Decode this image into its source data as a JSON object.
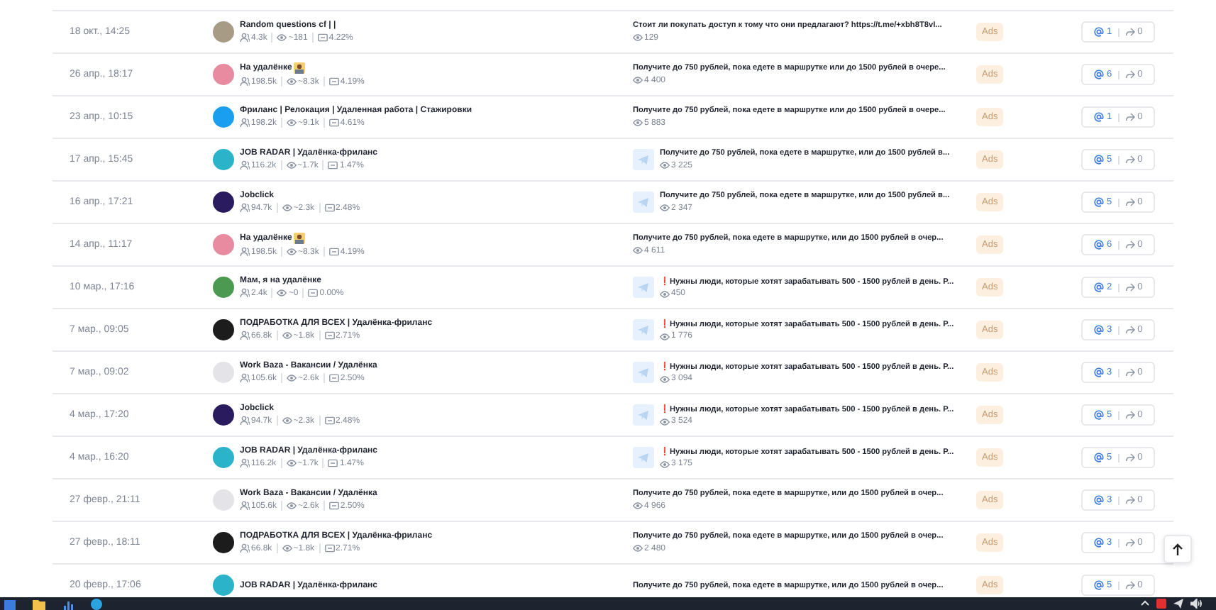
{
  "rows": [
    {
      "date": "18 окт., 14:25",
      "channel": {
        "name": "Random questions cf | |",
        "emoji": false,
        "color": "#a89b85",
        "subscribers": "4.3k",
        "reach": "~181",
        "er": "4.22%"
      },
      "post": {
        "thumb": false,
        "text": "Стоит ли покупать доступ к тому что они предлагают? https://t.me/+xbh8T8vI...",
        "views": "129"
      },
      "badge": "Ads",
      "mentions": "1",
      "reposts": "0"
    },
    {
      "date": "26 апр., 18:17",
      "channel": {
        "name": "На удалёнке",
        "emoji": true,
        "color": "#e88aa0",
        "subscribers": "198.5k",
        "reach": "~8.3k",
        "er": "4.19%"
      },
      "post": {
        "thumb": false,
        "text": "Получите до 750 рублей, пока едете в маршрутке или до 1500 рублей в очере...",
        "views": "4 400"
      },
      "badge": "Ads",
      "mentions": "6",
      "reposts": "0"
    },
    {
      "date": "23 апр., 10:15",
      "channel": {
        "name": "Фриланс | Релокация | Удаленная работа | Стажировки",
        "emoji": false,
        "color": "#1a9ff0",
        "subscribers": "198.2k",
        "reach": "~9.1k",
        "er": "4.61%"
      },
      "post": {
        "thumb": false,
        "text": "Получите до 750 рублей, пока едете в маршрутке или до 1500 рублей в очере...",
        "views": "5 883"
      },
      "badge": "Ads",
      "mentions": "1",
      "reposts": "0"
    },
    {
      "date": "17 апр., 15:45",
      "channel": {
        "name": "JOB RADAR | Удалёнка-фриланс",
        "emoji": false,
        "color": "#2bb3c9",
        "subscribers": "116.2k",
        "reach": "~1.7k",
        "er": "1.47%"
      },
      "post": {
        "thumb": true,
        "text": "Получите до 750 рублей, пока едете в маршрутке, или до 1500 рублей в...",
        "views": "3 225"
      },
      "badge": "Ads",
      "mentions": "5",
      "reposts": "0"
    },
    {
      "date": "16 апр., 17:21",
      "channel": {
        "name": "Jobclick",
        "emoji": false,
        "color": "#2a1b5e",
        "subscribers": "94.7k",
        "reach": "~2.3k",
        "er": "2.48%"
      },
      "post": {
        "thumb": true,
        "text": "Получите до 750 рублей, пока едете в маршрутке, или до 1500 рублей в...",
        "views": "2 347"
      },
      "badge": "Ads",
      "mentions": "5",
      "reposts": "0"
    },
    {
      "date": "14 апр., 11:17",
      "channel": {
        "name": "На удалёнке",
        "emoji": true,
        "color": "#e88aa0",
        "subscribers": "198.5k",
        "reach": "~8.3k",
        "er": "4.19%"
      },
      "post": {
        "thumb": false,
        "text": "Получите до 750 рублей, пока едете в маршрутке, или до 1500 рублей в очер...",
        "views": "4 611"
      },
      "badge": "Ads",
      "mentions": "6",
      "reposts": "0"
    },
    {
      "date": "10 мар., 17:16",
      "channel": {
        "name": "Мам, я на удалёнке",
        "emoji": false,
        "color": "#4c9a52",
        "subscribers": "2.4k",
        "reach": "~0",
        "er": "0.00%"
      },
      "post": {
        "thumb": true,
        "text": "❗Нужны люди, которые хотят зарабатывать 500 - 1500 рублей в день. Р...",
        "views": "450"
      },
      "badge": "Ads",
      "mentions": "2",
      "reposts": "0"
    },
    {
      "date": "7 мар., 09:05",
      "channel": {
        "name": "ПОДРАБОТКА ДЛЯ ВСЕХ | Удалёнка-фриланс",
        "emoji": false,
        "color": "#1c1c1c",
        "subscribers": "66.8k",
        "reach": "~1.8k",
        "er": "2.71%"
      },
      "post": {
        "thumb": true,
        "text": "❗Нужны люди, которые хотят зарабатывать 500 - 1500 рублей в день. Р...",
        "views": "1 776"
      },
      "badge": "Ads",
      "mentions": "3",
      "reposts": "0"
    },
    {
      "date": "7 мар., 09:02",
      "channel": {
        "name": "Work Baza - Вакансии / Удалёнка",
        "emoji": false,
        "color": "#e4e4e8",
        "subscribers": "105.6k",
        "reach": "~2.6k",
        "er": "2.50%"
      },
      "post": {
        "thumb": true,
        "text": "❗Нужны люди, которые хотят зарабатывать 500 - 1500 рублей в день. Р...",
        "views": "3 094"
      },
      "badge": "Ads",
      "mentions": "3",
      "reposts": "0"
    },
    {
      "date": "4 мар., 17:20",
      "channel": {
        "name": "Jobclick",
        "emoji": false,
        "color": "#2a1b5e",
        "subscribers": "94.7k",
        "reach": "~2.3k",
        "er": "2.48%"
      },
      "post": {
        "thumb": true,
        "text": "❗Нужны люди, которые хотят зарабатывать 500 - 1500 рублей в день. Р...",
        "views": "3 524"
      },
      "badge": "Ads",
      "mentions": "5",
      "reposts": "0"
    },
    {
      "date": "4 мар., 16:20",
      "channel": {
        "name": "JOB RADAR | Удалёнка-фриланс",
        "emoji": false,
        "color": "#2bb3c9",
        "subscribers": "116.2k",
        "reach": "~1.7k",
        "er": "1.47%"
      },
      "post": {
        "thumb": true,
        "text": "❗Нужны люди, которые хотят зарабатывать 500 - 1500 рублей в день. Р...",
        "views": "3 175"
      },
      "badge": "Ads",
      "mentions": "5",
      "reposts": "0"
    },
    {
      "date": "27 февр., 21:11",
      "channel": {
        "name": "Work Baza - Вакансии / Удалёнка",
        "emoji": false,
        "color": "#e4e4e8",
        "subscribers": "105.6k",
        "reach": "~2.6k",
        "er": "2.50%"
      },
      "post": {
        "thumb": false,
        "text": "Получите до 750 рублей, пока едете в маршрутке, или до 1500 рублей в очер...",
        "views": "4 966"
      },
      "badge": "Ads",
      "mentions": "3",
      "reposts": "0"
    },
    {
      "date": "27 февр., 18:11",
      "channel": {
        "name": "ПОДРАБОТКА ДЛЯ ВСЕХ | Удалёнка-фриланс",
        "emoji": false,
        "color": "#1c1c1c",
        "subscribers": "66.8k",
        "reach": "~1.8k",
        "er": "2.71%"
      },
      "post": {
        "thumb": false,
        "text": "Получите до 750 рублей, пока едете в маршрутке, или до 1500 рублей в очер...",
        "views": "2 480"
      },
      "badge": "Ads",
      "mentions": "3",
      "reposts": "0"
    },
    {
      "date": "20 февр., 17:06",
      "channel": {
        "name": "JOB RADAR | Удалёнка-фриланс",
        "emoji": false,
        "color": "#2bb3c9"
      },
      "post": {
        "thumb": false,
        "text": "Получите до 750 рублей, пока едете в маршрутке, или до 1500 рублей в очер..."
      },
      "badge": "Ads",
      "mentions": "5",
      "reposts": "0"
    }
  ]
}
